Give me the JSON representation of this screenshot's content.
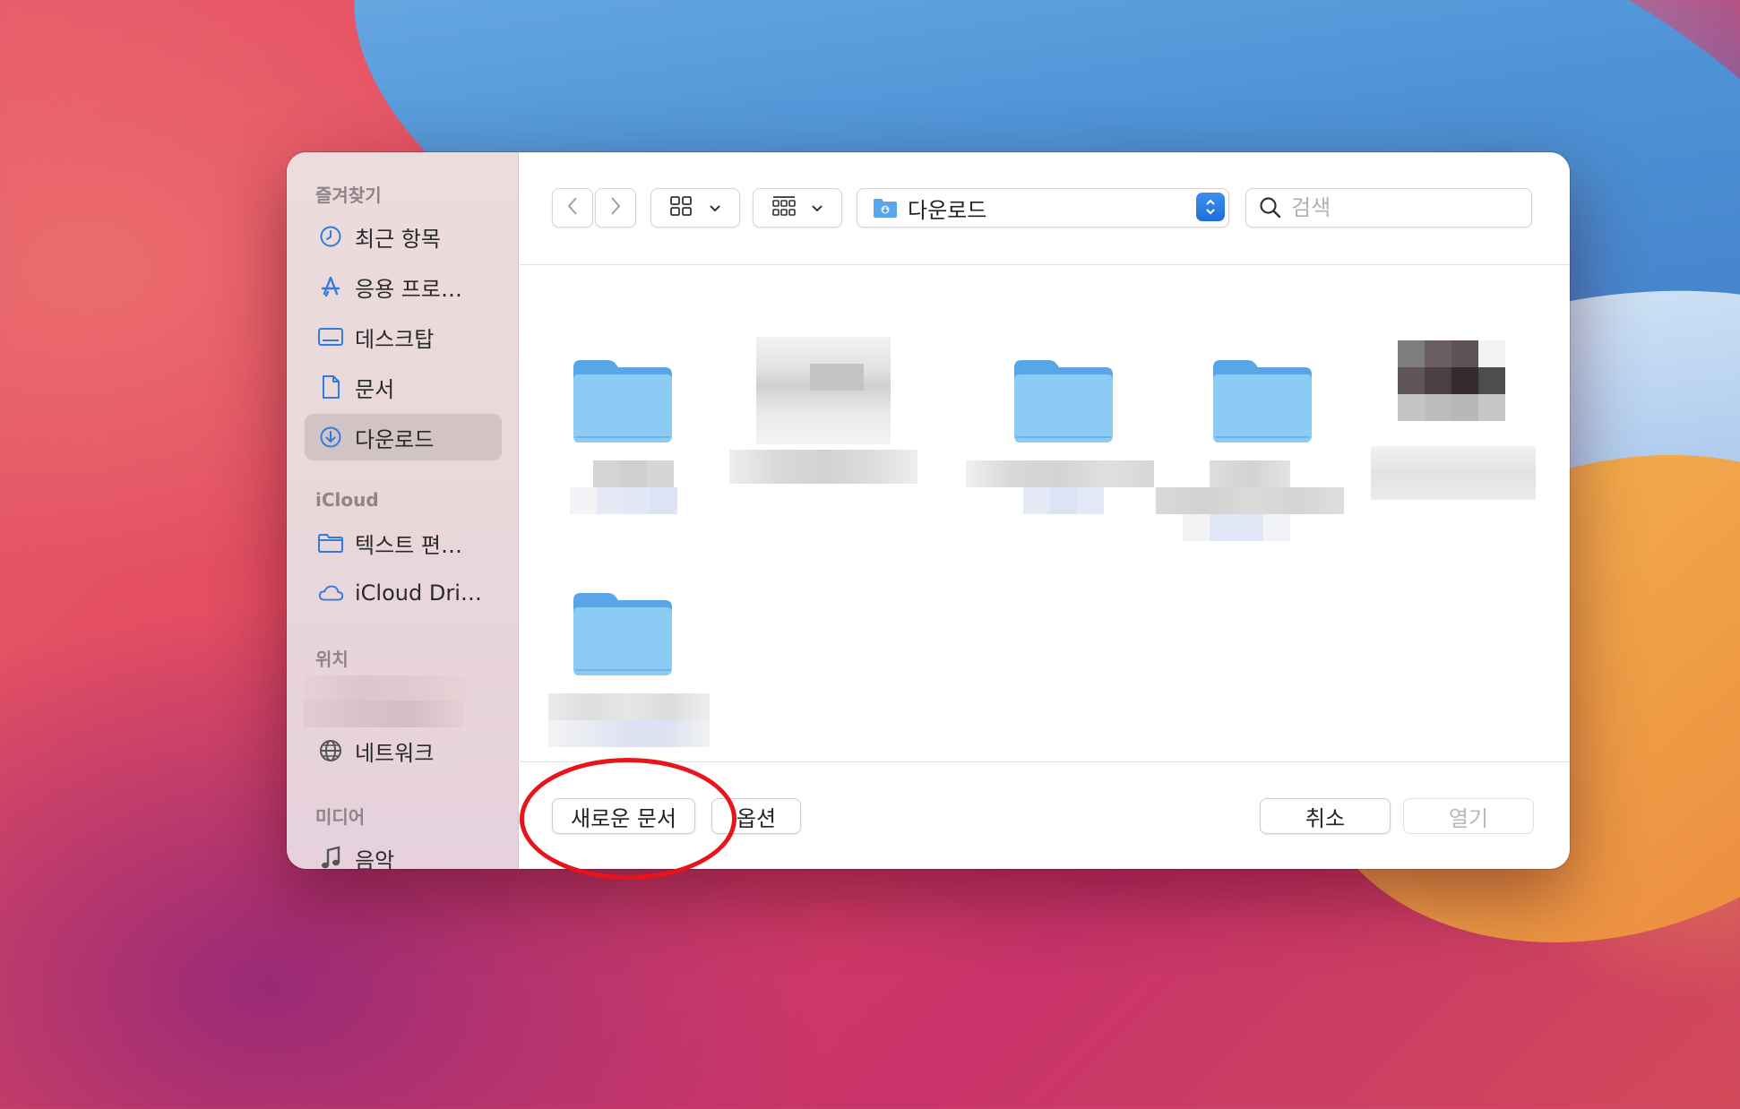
{
  "sidebar": {
    "favorites_title": "즐겨찾기",
    "favorites": [
      {
        "label": "최근 항목",
        "icon": "clock-icon"
      },
      {
        "label": "응용 프로…",
        "icon": "app-store-icon"
      },
      {
        "label": "데스크탑",
        "icon": "desktop-icon"
      },
      {
        "label": "문서",
        "icon": "document-icon"
      },
      {
        "label": "다운로드",
        "icon": "download-icon",
        "selected": true
      }
    ],
    "icloud_title": "iCloud",
    "icloud": [
      {
        "label": "텍스트 편…",
        "icon": "folder-icon"
      },
      {
        "label": "iCloud Dri…",
        "icon": "cloud-icon"
      }
    ],
    "locations_title": "위치",
    "locations": [
      {
        "label": "네트워크",
        "icon": "network-globe-icon"
      }
    ],
    "media_title": "미디어",
    "media": [
      {
        "label": "음악",
        "icon": "music-note-icon"
      }
    ]
  },
  "toolbar": {
    "current_folder": "다운로드",
    "search_placeholder": "검색"
  },
  "bottom": {
    "new_document": "새로운 문서",
    "options": "옵션",
    "cancel": "취소",
    "open": "열기"
  },
  "colors": {
    "accent": "#1f6fdc",
    "folder": "#8ccbf4",
    "highlight_ring": "#e8141c"
  }
}
